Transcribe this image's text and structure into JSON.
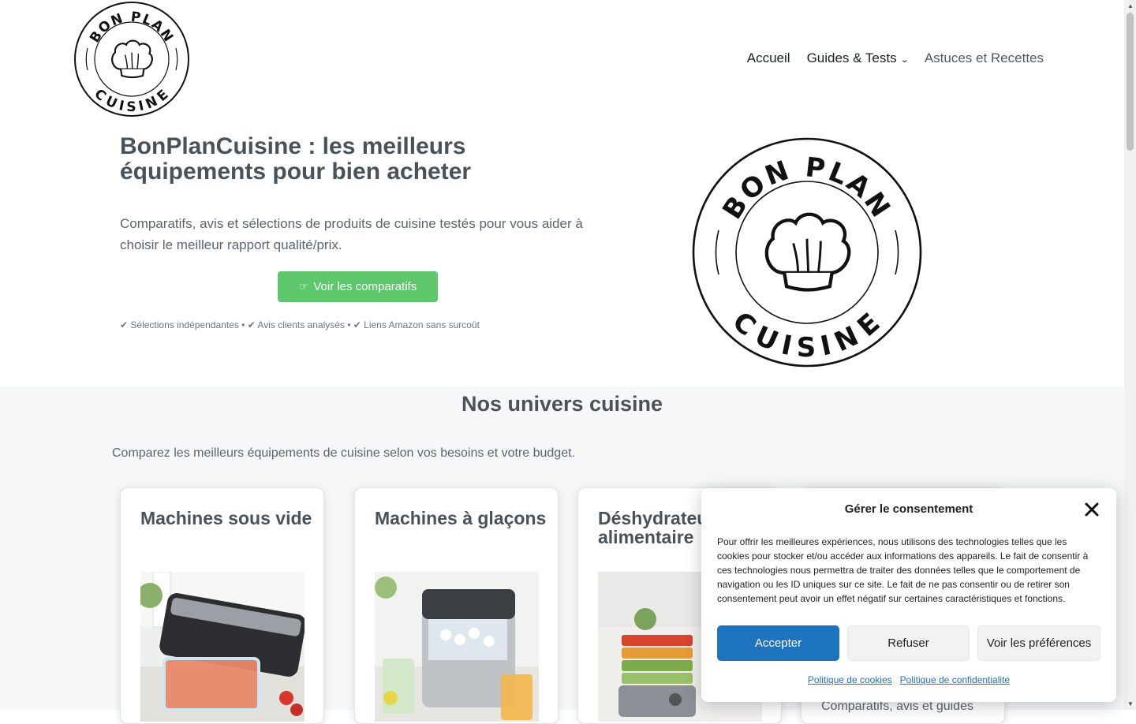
{
  "header": {
    "logo_top": "BON PLAN",
    "logo_bottom": "CUISINE",
    "nav": [
      {
        "label": "Accueil"
      },
      {
        "label": "Guides & Tests"
      },
      {
        "label": "Astuces et Recettes"
      }
    ]
  },
  "hero": {
    "title": "BonPlanCuisine : les meilleurs équipements pour bien acheter",
    "description": "Comparatifs, avis et sélections de produits de cuisine testés pour vous aider à choisir le meilleur rapport qualité/prix.",
    "cta_label": "Voir les comparatifs",
    "trust_line": "✔ Sélections indépendantes • ✔ Avis clients analysés • ✔ Liens Amazon sans surcoût"
  },
  "section": {
    "title": "Nos univers cuisine",
    "subtitle": "Comparez les meilleurs équipements de cuisine selon vos besoins et votre budget.",
    "cards": [
      {
        "title": "Machines sous vide"
      },
      {
        "title": "Machines à glaçons"
      },
      {
        "title": "Déshydrateur alimentaire"
      },
      {
        "title": "",
        "text": "Comparatifs, avis et guides"
      }
    ]
  },
  "consent": {
    "title": "Gérer le consentement",
    "text": "Pour offrir les meilleures expériences, nous utilisons des technologies telles que les cookies pour stocker et/ou accéder aux informations des appareils. Le fait de consentir à ces technologies nous permettra de traiter des données telles que le comportement de navigation ou les ID uniques sur ce site. Le fait de ne pas consentir ou de retirer son consentement peut avoir un effet négatif sur certaines caractéristiques et fonctions.",
    "accept": "Accepter",
    "deny": "Refuser",
    "prefs": "Voir les préférences",
    "cookie_policy": "Politique de cookies",
    "privacy_policy": "Politique de confidentialite"
  },
  "colors": {
    "cta": "#5ec66b",
    "accept": "#1e73be",
    "section_bg": "#f6f7f9"
  }
}
